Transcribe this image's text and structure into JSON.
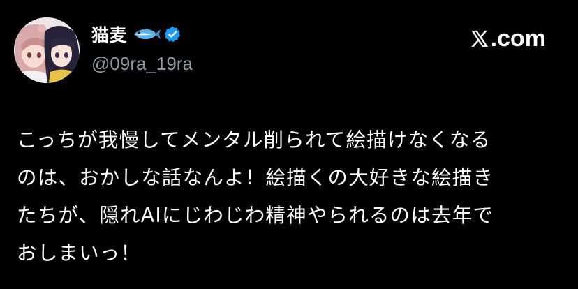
{
  "user": {
    "display_name": "猫麦",
    "name_emoji": "fish-icon",
    "verified_icon": "verified-badge-icon",
    "handle": "@09ra_19ra"
  },
  "brand": {
    "text": ".com",
    "logo": "x-logo-icon"
  },
  "tweet": {
    "lines": [
      "こっちが我慢してメンタル削られて絵描けなくなる",
      "のは、おかしな話なんよ！絵描くの大好きな絵描き",
      "たちが、隠れAIにじわじわ精神やられるのは去年で",
      "おしまいっ！"
    ]
  },
  "colors": {
    "background": "#000000",
    "text": "#ffffff",
    "handle": "#8b98a5",
    "verified": "#1d9bf0",
    "fish": "#5fb2e8"
  }
}
